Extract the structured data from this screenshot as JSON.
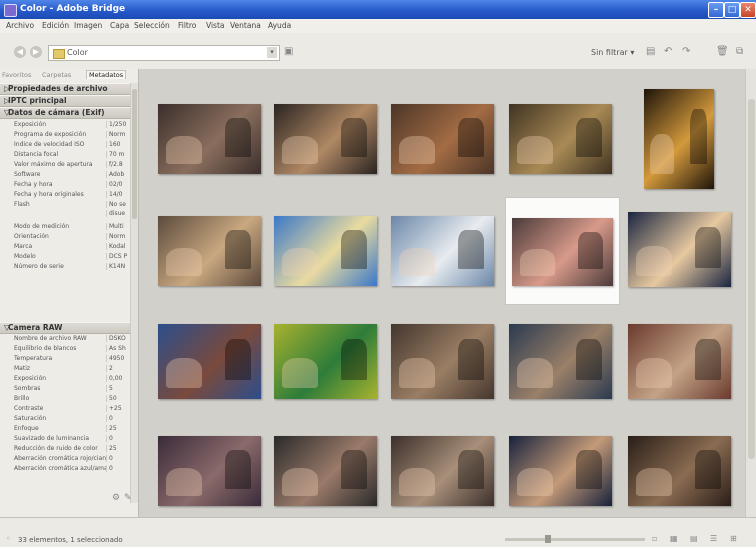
{
  "window": {
    "title": "Color - Adobe Bridge"
  },
  "menu": [
    "Archivo",
    "Edición",
    "Imagen",
    "Capa",
    "Selección",
    "Filtro",
    "Vista",
    "Ventana",
    "Ayuda"
  ],
  "toolbar": {
    "path": "Color",
    "filter": "Sin filtrar ▾"
  },
  "panel": {
    "tabs": [
      "Favoritos",
      "Carpetas",
      "Metadatos"
    ],
    "sections": {
      "file_props": "Propiedades de archivo",
      "iptc": "IPTC principal",
      "exif": "Datos de cámara (Exif)",
      "raw": "Camera RAW"
    },
    "exif_rows": [
      {
        "k": "Exposición",
        "v": "1/250"
      },
      {
        "k": "Programa de exposición",
        "v": "Norm"
      },
      {
        "k": "Índice de velocidad ISO",
        "v": "160"
      },
      {
        "k": "Distancia focal",
        "v": "70 m"
      },
      {
        "k": "Valor máximo de apertura",
        "v": "f/2.8"
      },
      {
        "k": "Software",
        "v": "Adob"
      },
      {
        "k": "Fecha y hora",
        "v": "02/0"
      },
      {
        "k": "Fecha y hora originales",
        "v": "14/0"
      },
      {
        "k": "Flash",
        "v": "No se"
      },
      {
        "k": "",
        "v": "disue"
      },
      {
        "k": "Modo de medición",
        "v": "Multi"
      },
      {
        "k": "Orientación",
        "v": "Norm"
      },
      {
        "k": "Marca",
        "v": "Kodal"
      },
      {
        "k": "Modelo",
        "v": "DCS P"
      },
      {
        "k": "Número de serie",
        "v": "K14N"
      }
    ],
    "raw_rows": [
      {
        "k": "Nombre de archivo RAW",
        "v": "DSKO"
      },
      {
        "k": "Equilibrio de blancos",
        "v": "As Sh"
      },
      {
        "k": "Temperatura",
        "v": "4950"
      },
      {
        "k": "Matiz",
        "v": "2"
      },
      {
        "k": "Exposición",
        "v": "0,00"
      },
      {
        "k": "Sombras",
        "v": "5"
      },
      {
        "k": "Brillo",
        "v": "50"
      },
      {
        "k": "Contraste",
        "v": "+25"
      },
      {
        "k": "Saturación",
        "v": "0"
      },
      {
        "k": "Enfoque",
        "v": "25"
      },
      {
        "k": "Suavizado de luminancia",
        "v": "0"
      },
      {
        "k": "Reducción de ruido de color",
        "v": "25"
      },
      {
        "k": "Aberración cromática rojo/cian",
        "v": "0"
      },
      {
        "k": "Aberración cromática azul/amarillo",
        "v": "0"
      }
    ]
  },
  "status": {
    "text": "33 elementos, 1 seleccionado"
  },
  "colors": {
    "titlebar": "#2457c8",
    "panel_bg": "#eeece7",
    "content_bg": "#d2d0cb"
  },
  "thumbnails": [
    {
      "c1": "#3b2f2c",
      "c2": "#8a6e5d"
    },
    {
      "c1": "#2a2421",
      "c2": "#b08864"
    },
    {
      "c1": "#4b3527",
      "c2": "#a36c44"
    },
    {
      "c1": "#403322",
      "c2": "#a98a55"
    },
    {
      "c1": "#1e140a",
      "c2": "#d49a3c"
    },
    {
      "c1": "#5c4a3d",
      "c2": "#c9a880"
    },
    {
      "c1": "#3b78c8",
      "c2": "#e9dba0"
    },
    {
      "c1": "#6b86a8",
      "c2": "#e8ecef"
    },
    {
      "c1": "#4a3a3a",
      "c2": "#d89a8a"
    },
    {
      "c1": "#1a2540",
      "c2": "#e7c9a0"
    },
    {
      "c1": "#2c4e8c",
      "c2": "#7a4a3c"
    },
    {
      "c1": "#a8b22e",
      "c2": "#2d7c3a"
    },
    {
      "c1": "#44362e",
      "c2": "#9a7e64"
    },
    {
      "c1": "#2a3a50",
      "c2": "#9a8068"
    },
    {
      "c1": "#6a3a2e",
      "c2": "#c3a286"
    },
    {
      "c1": "#3a2b3a",
      "c2": "#8a6a6a"
    },
    {
      "c1": "#2a2a2a",
      "c2": "#9a7a6a"
    },
    {
      "c1": "#3c2f2a",
      "c2": "#a88f7a"
    },
    {
      "c1": "#17223c",
      "c2": "#c49a78"
    },
    {
      "c1": "#2a1e18",
      "c2": "#8a6c52"
    }
  ]
}
